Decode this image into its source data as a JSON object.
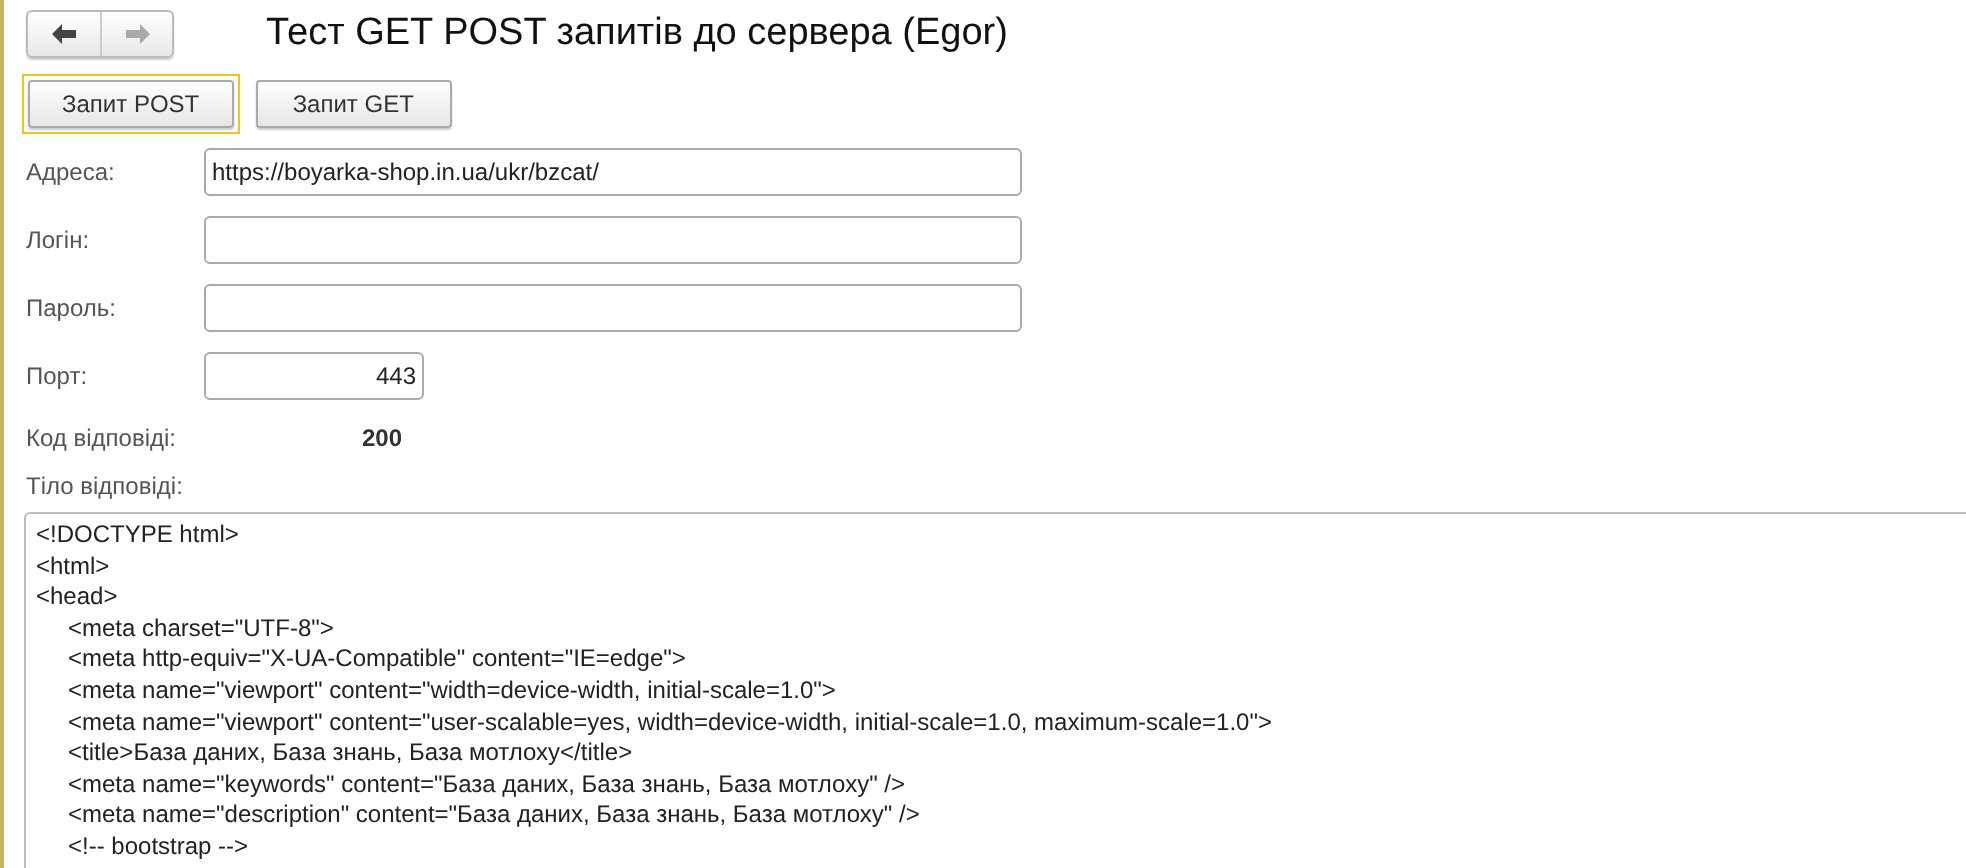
{
  "nav": {
    "back": {
      "disabled": false
    },
    "forward": {
      "disabled": true
    }
  },
  "title": "Тест GET POST запитів до сервера (Egor)",
  "buttons": [
    {
      "label": "Запит POST",
      "focused": true
    },
    {
      "label": "Запит GET",
      "focused": false
    }
  ],
  "fields": [
    {
      "label": "Адреса:",
      "value": "https://boyarka-shop.in.ua/ukr/bzcat/",
      "kind": "text"
    },
    {
      "label": "Логін:",
      "kind": "text"
    },
    {
      "label": "Пароль:",
      "kind": "text"
    },
    {
      "label": "Порт:",
      "value": "443",
      "kind": "number"
    }
  ],
  "response_code": {
    "label": "Код відповіді:",
    "value": "200"
  },
  "response_body": {
    "label": "Тіло відповіді:",
    "value": "<!DOCTYPE html>\n<html>\n<head>\n\t<meta charset=\"UTF-8\">\n\t<meta http-equiv=\"X-UA-Compatible\" content=\"IE=edge\">\n\t<meta name=\"viewport\" content=\"width=device-width, initial-scale=1.0\">\n\t<meta name=\"viewport\" content=\"user-scalable=yes, width=device-width, initial-scale=1.0, maximum-scale=1.0\">\n\t<title>База даних, База знань, База мотлоху</title>\n\t<meta name=\"keywords\" content=\"База даних, База знань, База мотлоху\" />\n\t<meta name=\"description\" content=\"База даних, База знань, База мотлоху\" />\n\t<!-- bootstrap -->"
  }
}
